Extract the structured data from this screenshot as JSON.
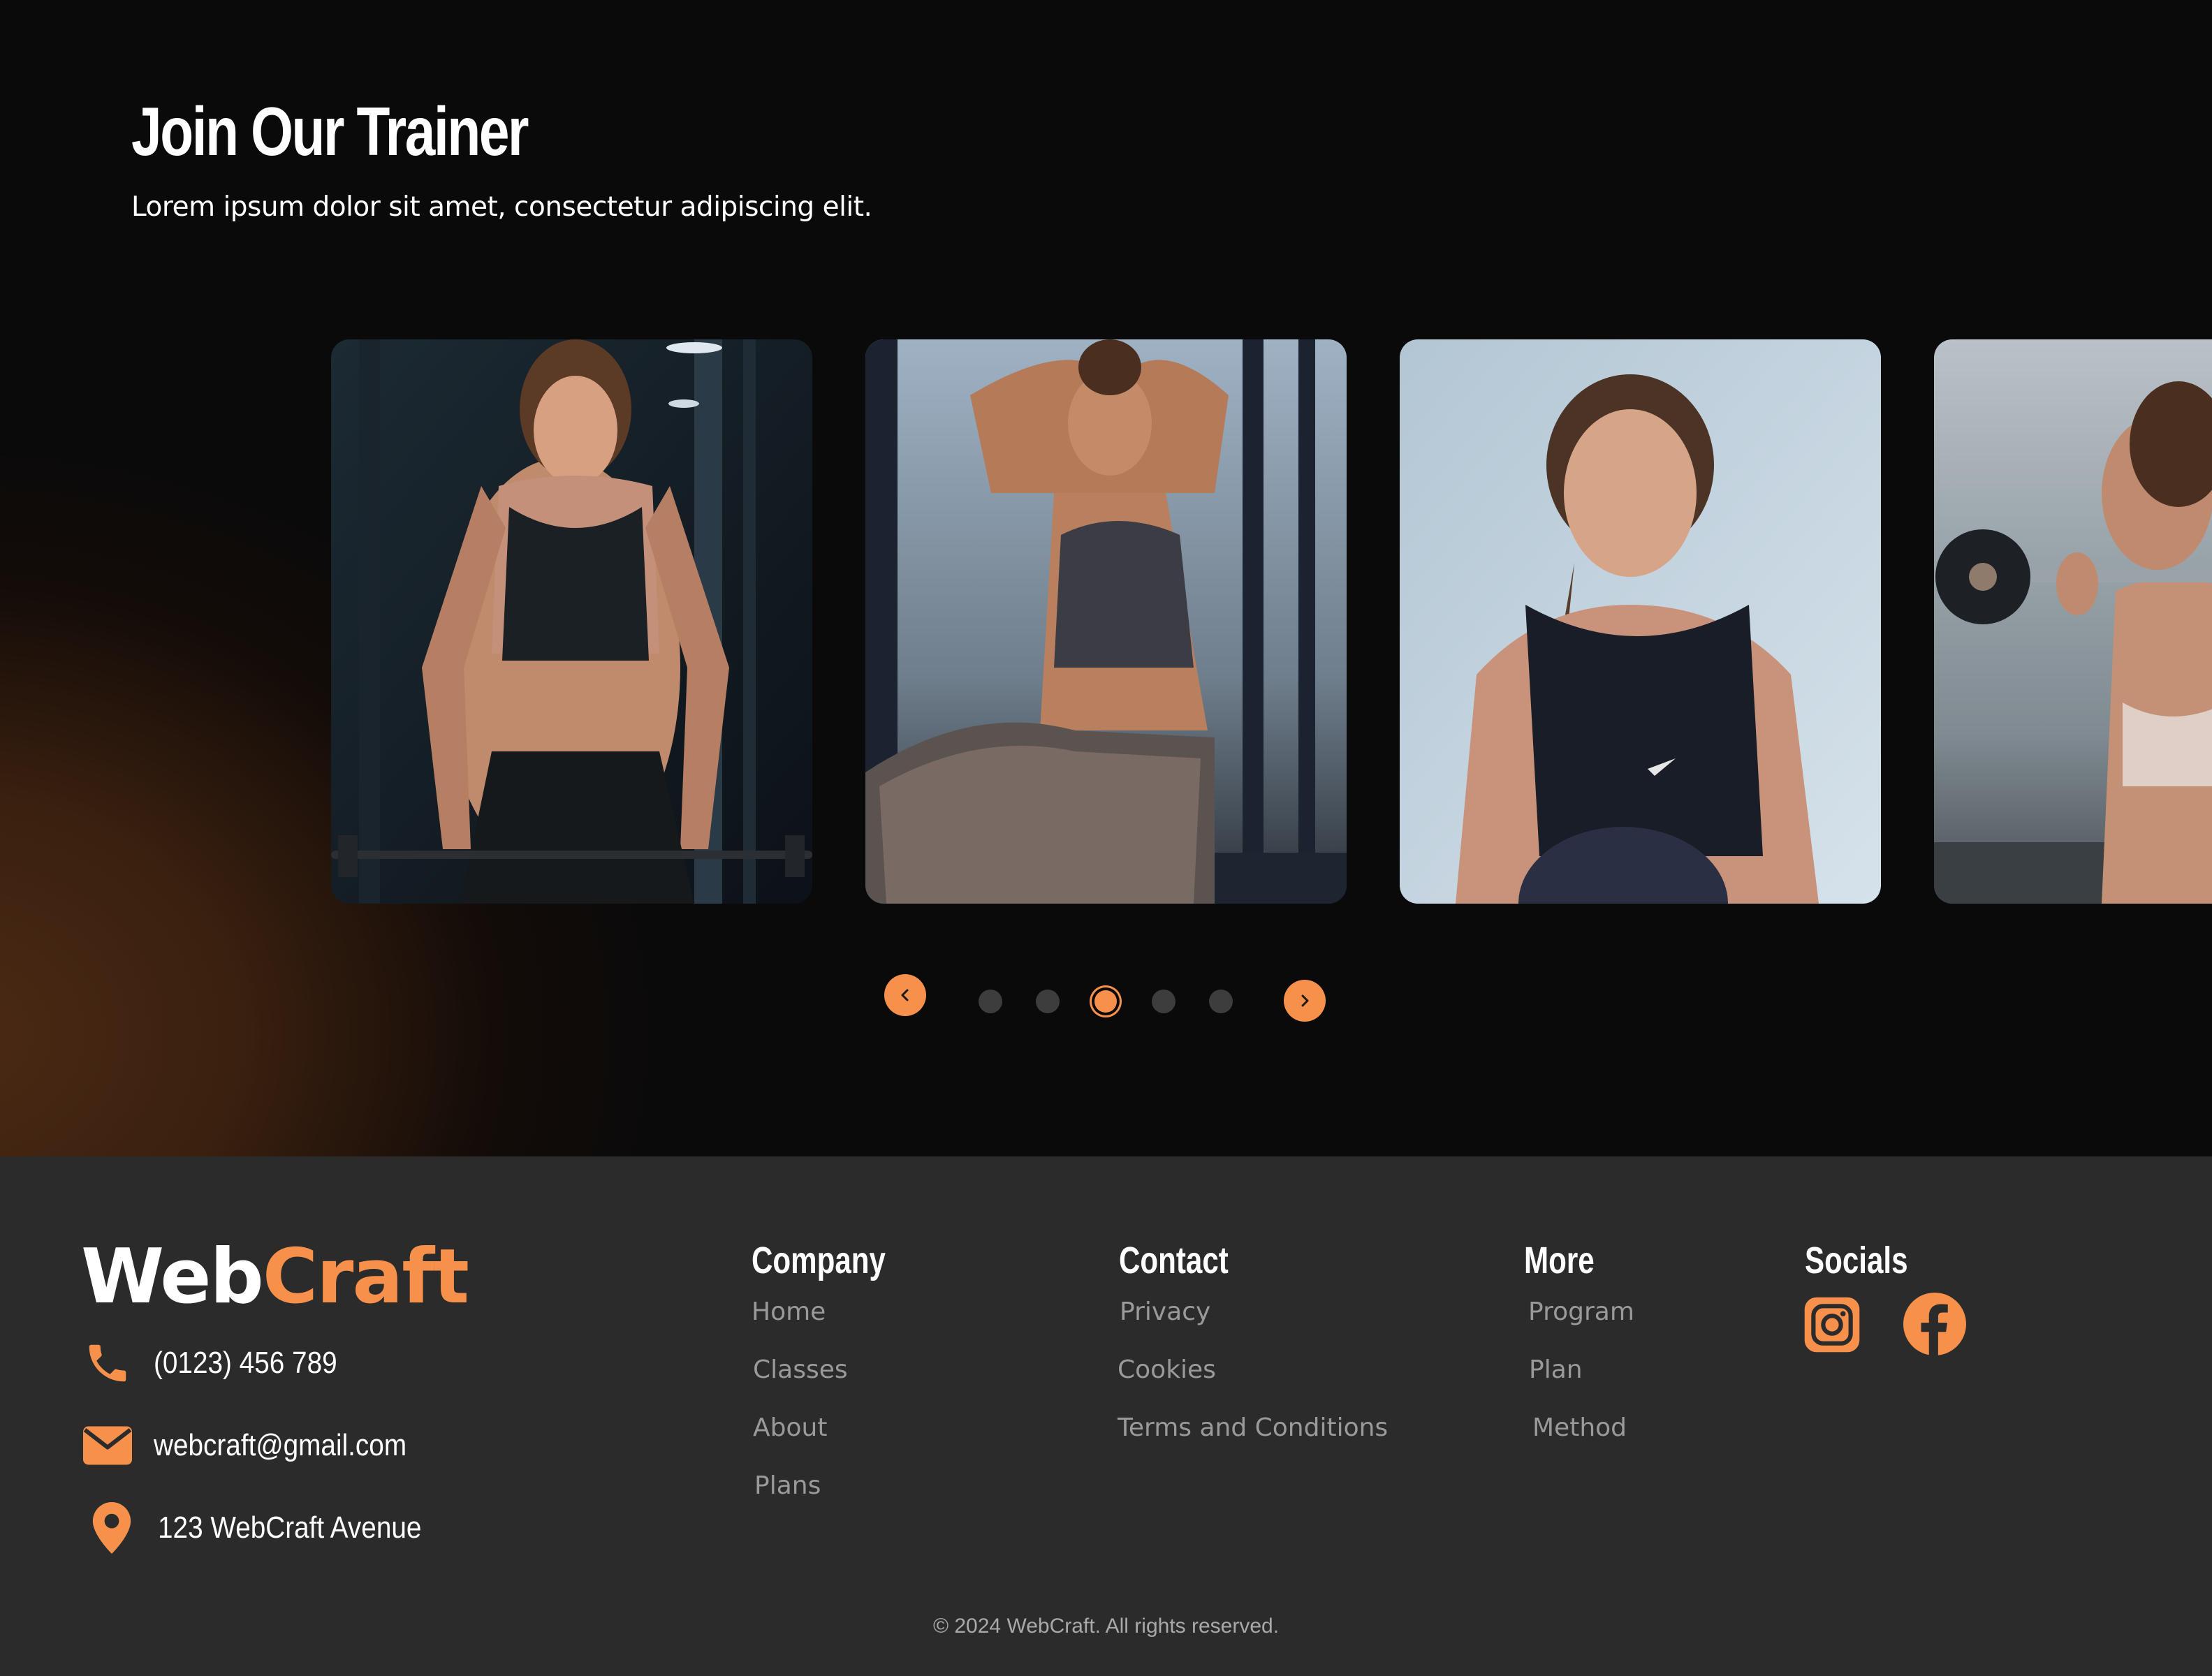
{
  "hero": {
    "title": "Join Our Trainer",
    "subtitle": "Lorem ipsum dolor sit amet, consectetur adipiscing elit."
  },
  "carousel": {
    "cards": [
      {
        "image": "trainer-photo-gym-barbell"
      },
      {
        "image": "trainer-photo-window-stretch"
      },
      {
        "image": "trainer-photo-portrait-ball"
      },
      {
        "image": "trainer-photo-barbell-curl"
      }
    ],
    "dots_count": 5,
    "active_dot": 3,
    "prev_icon": "chevron-left-icon",
    "next_icon": "chevron-right-icon"
  },
  "footer": {
    "brand": {
      "part1": "Web",
      "part2": "Craft"
    },
    "contact": {
      "phone": "(0123) 456 789",
      "email": "webcraft@gmail.com",
      "address": "123 WebCraft Avenue"
    },
    "columns": {
      "company": {
        "title": "Company",
        "links": [
          "Home",
          "Classes",
          "About",
          "Plans"
        ]
      },
      "contact": {
        "title": "Contact",
        "links": [
          "Privacy",
          "Cookies",
          "Terms and Conditions"
        ]
      },
      "more": {
        "title": "More",
        "links": [
          "Program",
          "Plan",
          "Method"
        ]
      },
      "socials": {
        "title": "Socials",
        "icons": [
          "instagram-icon",
          "facebook-icon"
        ]
      }
    },
    "copyright": "© 2024 WebCraft. All rights reserved."
  },
  "colors": {
    "accent": "#f7904a",
    "background": "#0a0a0a",
    "footer": "#2b2b2b",
    "link": "#9a9a9a"
  }
}
